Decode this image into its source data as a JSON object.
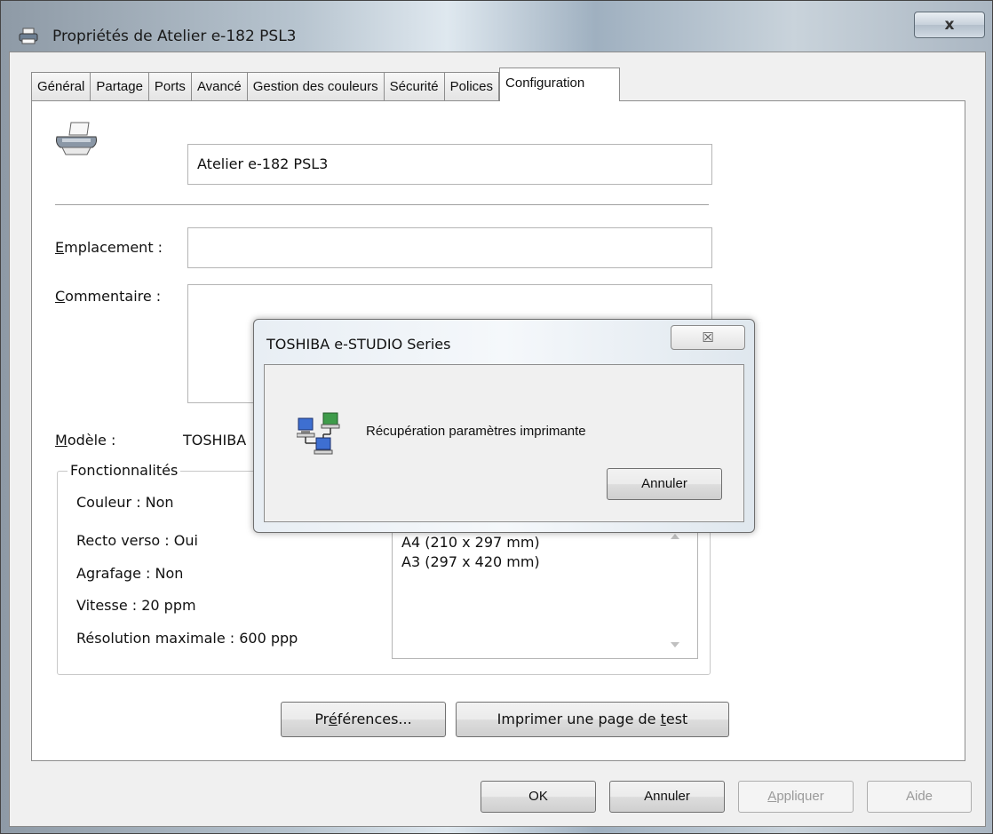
{
  "window": {
    "title": "Propriétés de Atelier e-182 PSL3",
    "close_glyph": "x"
  },
  "tabs": [
    {
      "label": "Général"
    },
    {
      "label": "Partage"
    },
    {
      "label": "Ports"
    },
    {
      "label": "Avancé"
    },
    {
      "label": "Gestion des couleurs"
    },
    {
      "label": "Sécurité"
    },
    {
      "label": "Polices"
    },
    {
      "label": "Configuration",
      "active": true
    }
  ],
  "general": {
    "printer_name": "Atelier e-182 PSL3",
    "location_label_first": "E",
    "location_label_rest": "mplacement :",
    "location_value": "",
    "comment_label_first": "C",
    "comment_label_rest": "ommentaire :",
    "comment_value": "",
    "model_label_first": "M",
    "model_label_rest": "odèle :",
    "model_value": "TOSHIBA"
  },
  "features": {
    "group_title": "Fonctionnalités",
    "items": [
      "Couleur : Non",
      "Recto verso : Oui",
      "Agrafage : Non",
      "Vitesse : 20 ppm",
      "Résolution maximale : 600 ppp"
    ],
    "paper_sizes": [
      "A4 (210 x 297 mm)",
      "A3 (297 x 420 mm)"
    ]
  },
  "buttons": {
    "preferences_pre": "Pr",
    "preferences_u": "é",
    "preferences_post": "férences...",
    "testpage_pre": "Imprimer une page de ",
    "testpage_u": "t",
    "testpage_post": "est",
    "ok": "OK",
    "cancel": "Annuler",
    "apply_u": "A",
    "apply_rest": "ppliquer",
    "help": "Aide"
  },
  "dialog": {
    "title": "TOSHIBA e-STUDIO Series",
    "close_glyph": "☒",
    "message": "Récupération paramètres imprimante",
    "cancel": "Annuler"
  }
}
